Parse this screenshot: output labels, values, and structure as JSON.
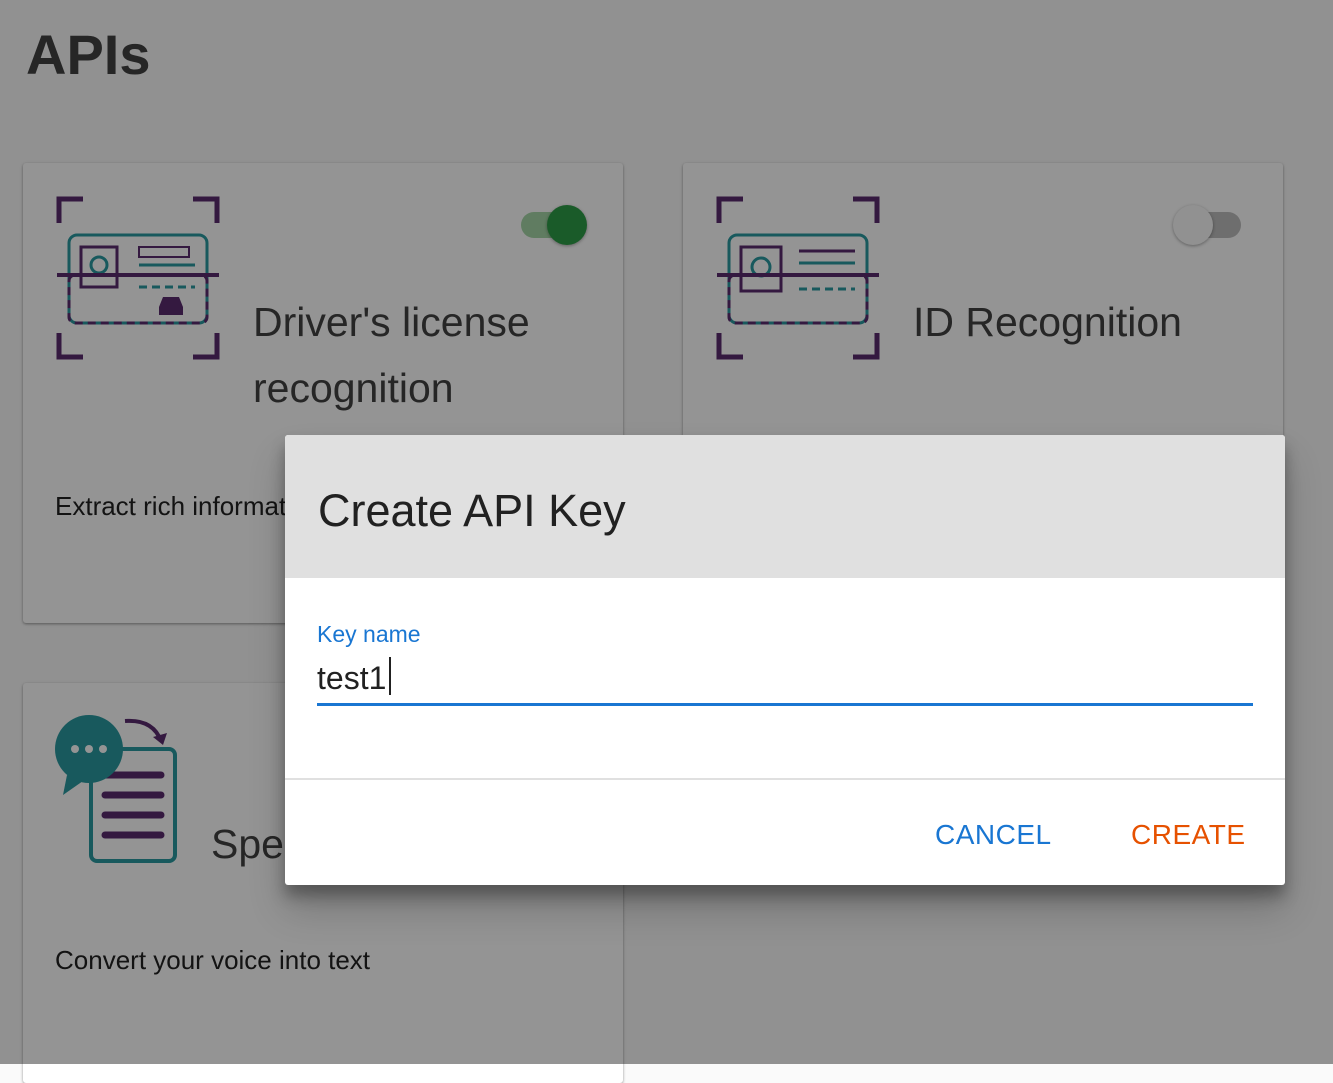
{
  "page": {
    "title": "APIs"
  },
  "cards": [
    {
      "title": "Driver's license recognition",
      "description": "Extract rich information from driver's license",
      "enabled": true,
      "icon": "drivers-license-scan-icon"
    },
    {
      "title": "ID Recognition",
      "description": "",
      "enabled": false,
      "icon": "id-card-scan-icon"
    },
    {
      "title": "Speech to text",
      "description": "Convert your voice into text",
      "icon": "speech-to-text-icon"
    }
  ],
  "dialog": {
    "title": "Create API Key",
    "field_label": "Key name",
    "field_value": "test1",
    "cancel_label": "CANCEL",
    "create_label": "CREATE"
  },
  "colors": {
    "primary": "#1976d2",
    "accent": "#e65100",
    "toggle_on": "#2e9e47",
    "icon_purple": "#5b2c6f",
    "icon_teal": "#2a9aa0"
  }
}
